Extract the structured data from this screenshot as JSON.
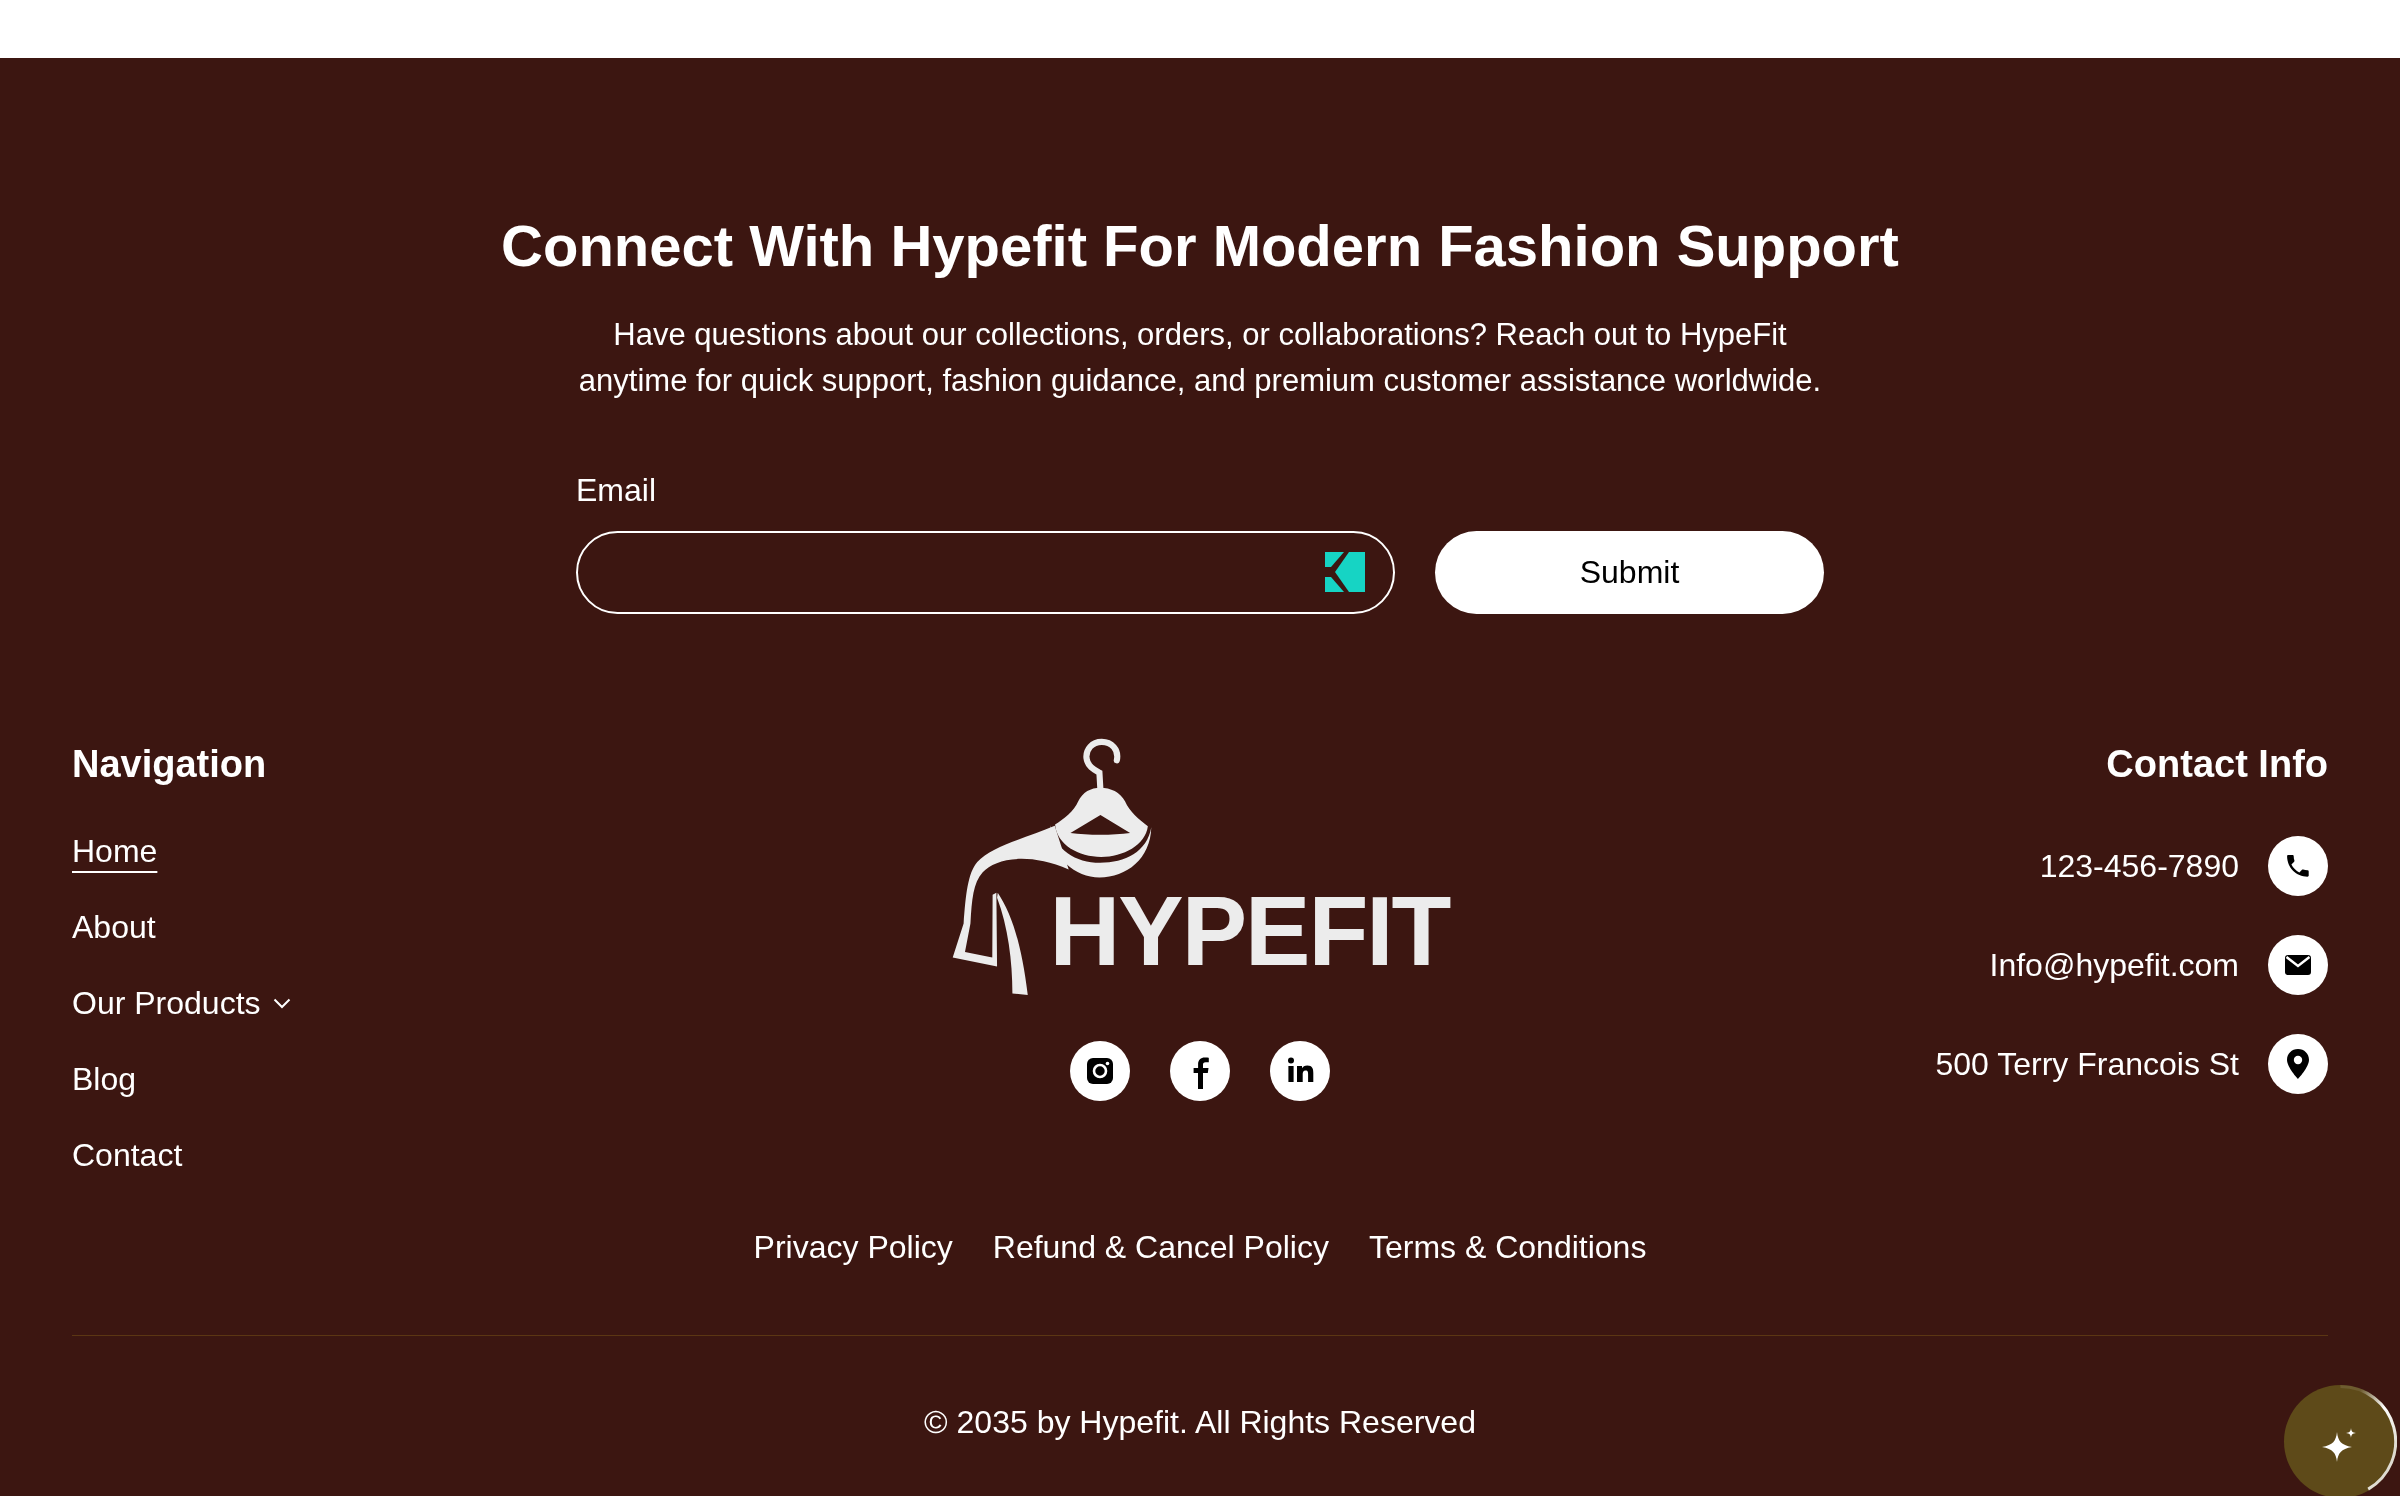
{
  "contact_section": {
    "heading": "Connect With Hypefit For Modern Fashion Support",
    "description": "Have questions about our collections, orders, or collaborations? Reach out to HypeFit anytime for quick support, fashion guidance, and premium customer assistance worldwide.",
    "email_field": {
      "label": "Email"
    },
    "submit_button": "Submit"
  },
  "navigation": {
    "heading": "Navigation",
    "items": [
      {
        "label": "Home",
        "kind": "link",
        "selected": true
      },
      {
        "label": "About",
        "kind": "link",
        "selected": false
      },
      {
        "label": "Our Products",
        "kind": "dropdown",
        "selected": false
      },
      {
        "label": "Blog",
        "kind": "link",
        "selected": false
      },
      {
        "label": "Contact",
        "kind": "link",
        "selected": false
      }
    ]
  },
  "logo": {
    "text": "HYPEFIT"
  },
  "contact_info": {
    "heading": "Contact Info",
    "items": [
      {
        "kind": "phone",
        "text": "123-456-7890"
      },
      {
        "kind": "email",
        "text": "Info@hypefit.com"
      },
      {
        "kind": "address",
        "text": "500 Terry Francois St"
      }
    ]
  },
  "legal_links": [
    "Privacy Policy",
    "Refund & Cancel Policy",
    "Terms & Conditions"
  ],
  "copyright": "© 2035 by Hypefit. All Rights Reserved"
}
